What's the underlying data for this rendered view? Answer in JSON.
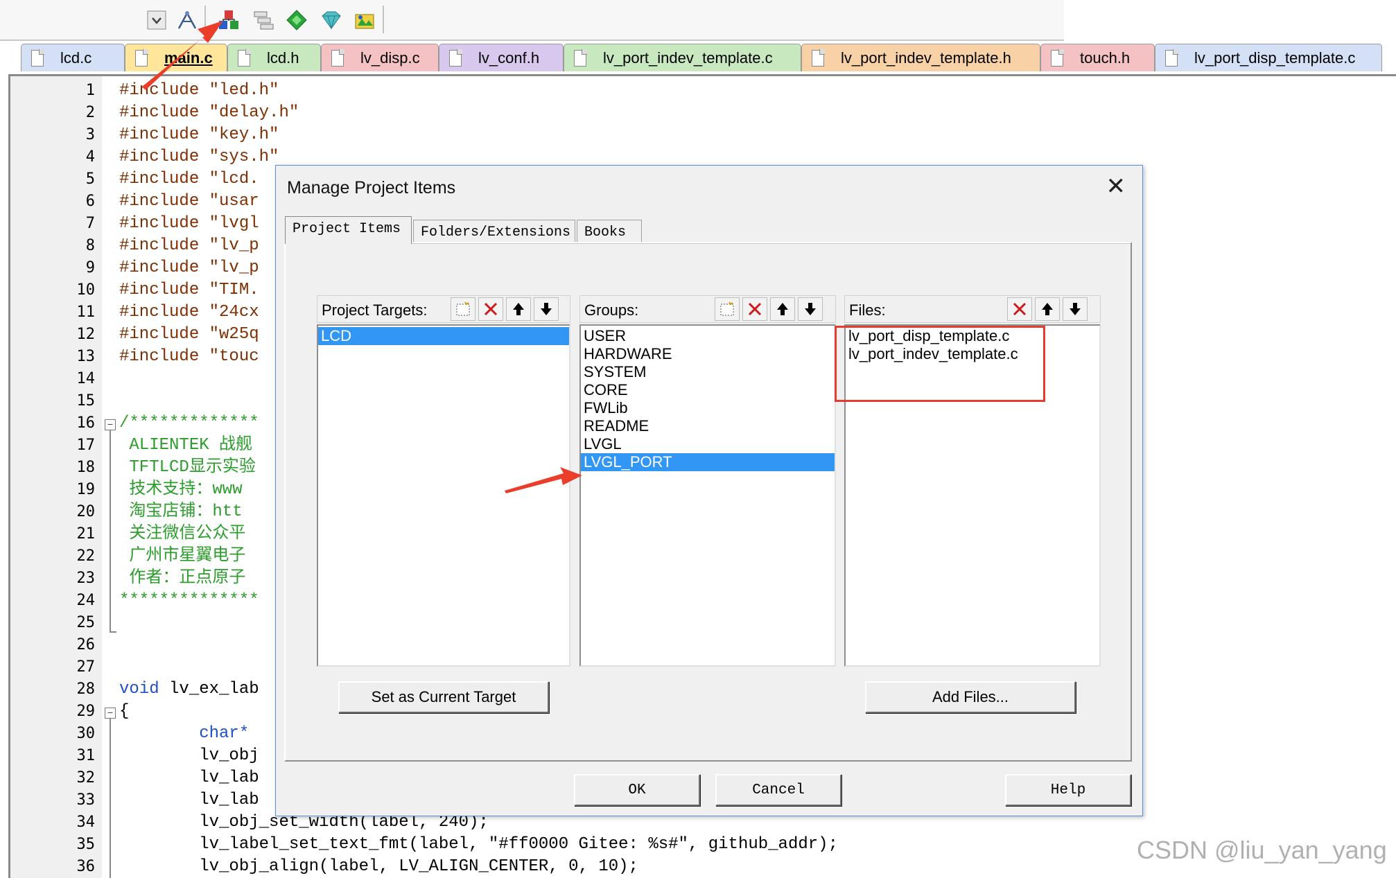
{
  "toolbar": {
    "buttons": [
      "dropdown-icon",
      "wizard-icon",
      "manage-project-items-icon",
      "batch-build-icon",
      "select-device-icon",
      "options-icon",
      "pack-installer-icon"
    ]
  },
  "tabs": [
    {
      "label": "lcd.c",
      "color": "#d4e0f6",
      "active": false
    },
    {
      "label": "main.c",
      "color": "#ffe69a",
      "active": true
    },
    {
      "label": "lcd.h",
      "color": "#c8e8c0",
      "active": false
    },
    {
      "label": "lv_disp.c",
      "color": "#f4c2c2",
      "active": false
    },
    {
      "label": "lv_conf.h",
      "color": "#d9c8ee",
      "active": false
    },
    {
      "label": "lv_port_indev_template.c",
      "color": "#c8e8c0",
      "active": false
    },
    {
      "label": "lv_port_indev_template.h",
      "color": "#f8d2a6",
      "active": false
    },
    {
      "label": "touch.h",
      "color": "#f4c2c2",
      "active": false
    },
    {
      "label": "lv_port_disp_template.c",
      "color": "#d4e0f6",
      "active": false
    }
  ],
  "code": [
    {
      "n": "1",
      "t": "#include \"led.h\"",
      "c": "pp"
    },
    {
      "n": "2",
      "t": "#include \"delay.h\"",
      "c": "pp"
    },
    {
      "n": "3",
      "t": "#include \"key.h\"",
      "c": "pp"
    },
    {
      "n": "4",
      "t": "#include \"sys.h\"",
      "c": "pp"
    },
    {
      "n": "5",
      "t": "#include \"lcd.",
      "c": "pp"
    },
    {
      "n": "6",
      "t": "#include \"usar",
      "c": "pp"
    },
    {
      "n": "7",
      "t": "#include \"lvgl",
      "c": "pp"
    },
    {
      "n": "8",
      "t": "#include \"lv_p",
      "c": "pp"
    },
    {
      "n": "9",
      "t": "#include \"lv_p",
      "c": "pp"
    },
    {
      "n": "10",
      "t": "#include \"TIM.",
      "c": "pp"
    },
    {
      "n": "11",
      "t": "#include \"24cx",
      "c": "pp"
    },
    {
      "n": "12",
      "t": "#include \"w25q",
      "c": "pp"
    },
    {
      "n": "13",
      "t": "#include \"touc",
      "c": "pp"
    },
    {
      "n": "14",
      "t": "",
      "c": "tx"
    },
    {
      "n": "15",
      "t": "",
      "c": "tx"
    },
    {
      "n": "16",
      "t": "/*************",
      "c": "com"
    },
    {
      "n": "17",
      "t": " ALIENTEK 战舰",
      "c": "com"
    },
    {
      "n": "18",
      "t": " TFTLCD显示实验",
      "c": "com"
    },
    {
      "n": "19",
      "t": " 技术支持：www",
      "c": "com"
    },
    {
      "n": "20",
      "t": " 淘宝店铺：htt",
      "c": "com"
    },
    {
      "n": "21",
      "t": " 关注微信公众平",
      "c": "com"
    },
    {
      "n": "22",
      "t": " 广州市星翼电子",
      "c": "com"
    },
    {
      "n": "23",
      "t": " 作者：正点原子",
      "c": "com"
    },
    {
      "n": "24",
      "t": "**************",
      "c": "com"
    },
    {
      "n": "25",
      "t": "",
      "c": "tx"
    },
    {
      "n": "26",
      "t": "",
      "c": "tx"
    },
    {
      "n": "27",
      "t": "",
      "c": "tx"
    },
    {
      "n": "28",
      "t": "void lv_ex_lab",
      "c": "kw"
    },
    {
      "n": "29",
      "t": "{",
      "c": "tx"
    },
    {
      "n": "30",
      "t": "        char*",
      "c": "kw"
    },
    {
      "n": "31",
      "t": "        lv_obj",
      "c": "tx"
    },
    {
      "n": "32",
      "t": "        lv_lab",
      "c": "tx"
    },
    {
      "n": "33",
      "t": "        lv_lab",
      "c": "tx"
    },
    {
      "n": "34",
      "t": "        lv_obj_set_width(label, 240);",
      "c": "tx"
    },
    {
      "n": "35",
      "t": "        lv_label_set_text_fmt(label, \"#ff0000 Gitee: %s#\", github_addr);",
      "c": "tx"
    },
    {
      "n": "36",
      "t": "        lv_obj_align(label, LV_ALIGN_CENTER, 0, 10);",
      "c": "tx"
    }
  ],
  "dialog": {
    "title": "Manage Project Items",
    "tabs": [
      "Project Items",
      "Folders/Extensions",
      "Books"
    ],
    "targets": {
      "label": "Project Targets:",
      "items": [
        "LCD"
      ],
      "selected": 0
    },
    "groups": {
      "label": "Groups:",
      "items": [
        "USER",
        "HARDWARE",
        "SYSTEM",
        "CORE",
        "FWLib",
        "README",
        "LVGL",
        "LVGL_PORT"
      ],
      "selected": 7
    },
    "files": {
      "label": "Files:",
      "items": [
        "lv_port_disp_template.c",
        "lv_port_indev_template.c"
      ]
    },
    "set_target_label": "Set as Current Target",
    "add_files_label": "Add Files...",
    "ok_label": "OK",
    "cancel_label": "Cancel",
    "help_label": "Help"
  },
  "watermark": "CSDN @liu_yan_yang",
  "colors": {
    "accent": "#3296f5",
    "annotation": "#e53c2e",
    "preprocessor": "#7f2f00",
    "comment": "#2a9d2a",
    "keyword": "#2050c8"
  }
}
